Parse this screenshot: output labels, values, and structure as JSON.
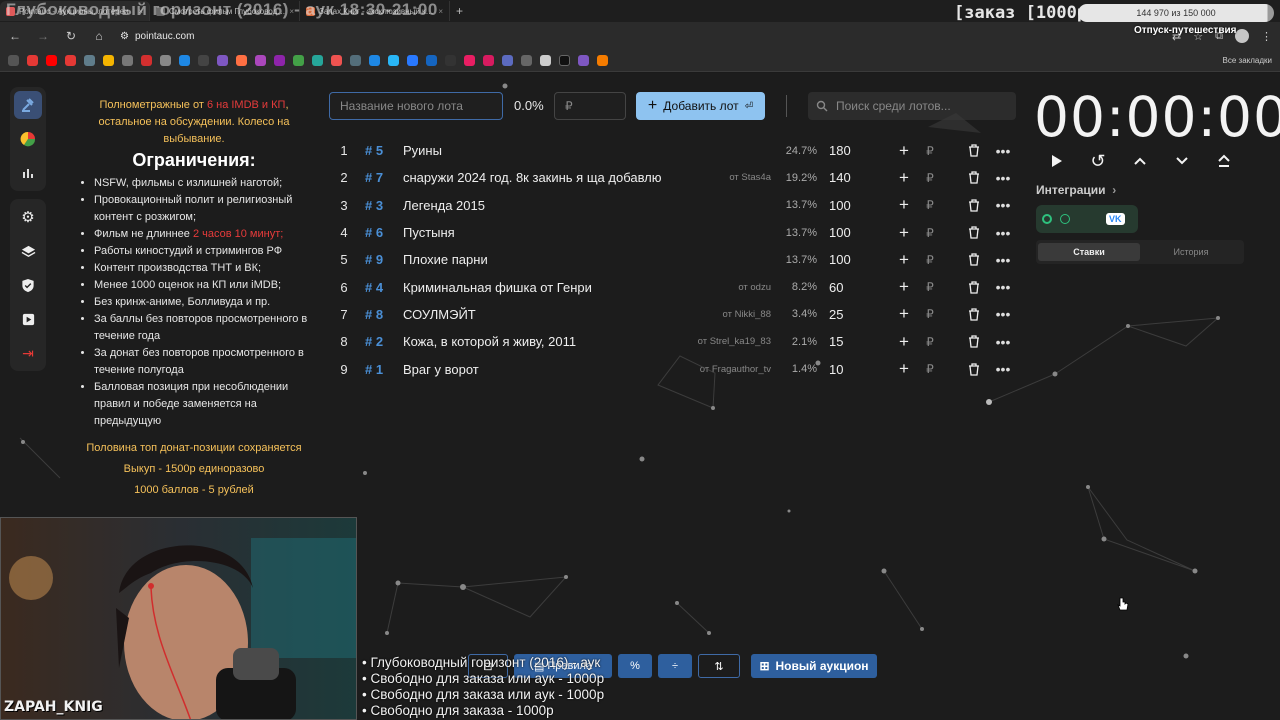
{
  "overlay": {
    "title": "Глубоководный горизонт (2016) - аук 18:30-21:00",
    "order_label": "[заказ [1000р]",
    "donation_progress": "144 970 из 150 000",
    "donation_fraction": 0.966,
    "donation_goal": "Отпуск-путешествия",
    "streamer": "ZAPAH_KNIG"
  },
  "browser": {
    "tabs": [
      {
        "label": "Pointauc - Аукционы, лотереи",
        "color": "#e05a5a"
      },
      {
        "label": "Смотреть фильм Глубоковод…",
        "color": "#6a6a6a"
      },
      {
        "label": "Запах Книг - эксклюзивный к…",
        "color": "#d86b3c"
      }
    ],
    "url": "pointauc.com",
    "all_bookmarks": "Все закладки"
  },
  "rules": {
    "intro_prefix": "Полнометражные от ",
    "intro_red": "6 на IMDB и КП",
    "intro_suffix": ", остальное на обсуждении. Колесо на выбывание.",
    "heading": "Ограничения:",
    "items": [
      "NSFW, фильмы с излишней наготой;",
      "Провокационный полит и религиозный контент с розжигом;",
      "Фильм не длиннее ",
      "Работы киностудий и стримингов РФ",
      "Контент производства ТНТ и ВК;",
      "Менее 1000 оценок на КП или iMDB;",
      "Без кринж-аниме, Болливуда и пр.",
      "За баллы без повторов просмотренного в течение года",
      "За донат без повторов просмотренного в течение полугода",
      "Балловая позиция при несоблюдении правил и победе заменяется на предыдущую"
    ],
    "duration_red": "2 часов 10 минут;",
    "footer": [
      "Половина топ донат-позиции сохраняется",
      "Выкуп - 1500р единоразово",
      "1000 баллов - 5 рублей"
    ]
  },
  "controls": {
    "new_lot_placeholder": "Название нового лота",
    "percent": "0.0%",
    "amount_placeholder": "₽",
    "add_button": "Добавить лот",
    "search_placeholder": "Поиск среди лотов..."
  },
  "lots": [
    {
      "index": "1",
      "id": "# 5",
      "name": "Руины",
      "author": "",
      "percent": "24.7%",
      "amount": "180"
    },
    {
      "index": "2",
      "id": "# 7",
      "name": "снаружи 2024 год. 8к закинь я ща добавлю",
      "author": "от Stas4a",
      "percent": "19.2%",
      "amount": "140"
    },
    {
      "index": "3",
      "id": "# 3",
      "name": "Легенда 2015",
      "author": "",
      "percent": "13.7%",
      "amount": "100"
    },
    {
      "index": "4",
      "id": "# 6",
      "name": "Пустыня",
      "author": "",
      "percent": "13.7%",
      "amount": "100"
    },
    {
      "index": "5",
      "id": "# 9",
      "name": "Плохие парни",
      "author": "",
      "percent": "13.7%",
      "amount": "100"
    },
    {
      "index": "6",
      "id": "# 4",
      "name": "Криминальная фишка от Генри",
      "author": "от odzu",
      "percent": "8.2%",
      "amount": "60"
    },
    {
      "index": "7",
      "id": "# 8",
      "name": "СОУЛМЭЙТ",
      "author": "от Nikki_88",
      "percent": "3.4%",
      "amount": "25"
    },
    {
      "index": "8",
      "id": "# 2",
      "name": "Кожа, в которой я живу, 2011",
      "author": "от Strel_ka19_83",
      "percent": "2.1%",
      "amount": "15"
    },
    {
      "index": "9",
      "id": "# 1",
      "name": "Враг у ворот",
      "author": "от Fragauthor_tv",
      "percent": "1.4%",
      "amount": "10"
    }
  ],
  "timer": {
    "value": "00:00:00",
    "integrations_label": "Интеграции",
    "tab_bids": "Ставки",
    "tab_history": "История"
  },
  "bottom": {
    "rules_button": "Правила",
    "new_auction": "Новый аукцион"
  },
  "queue": [
    "• Глубоководный горизонт (2016) - аук",
    "• Свободно для заказа или аук - 1000р",
    "• Свободно для заказа или аук - 1000р",
    "• Свободно для заказа - 1000р"
  ],
  "colors": {
    "accent": "#8ec3f0",
    "lot_id": "#4a8fd6",
    "gold": "#f5c15a",
    "red": "#e63b3b"
  }
}
